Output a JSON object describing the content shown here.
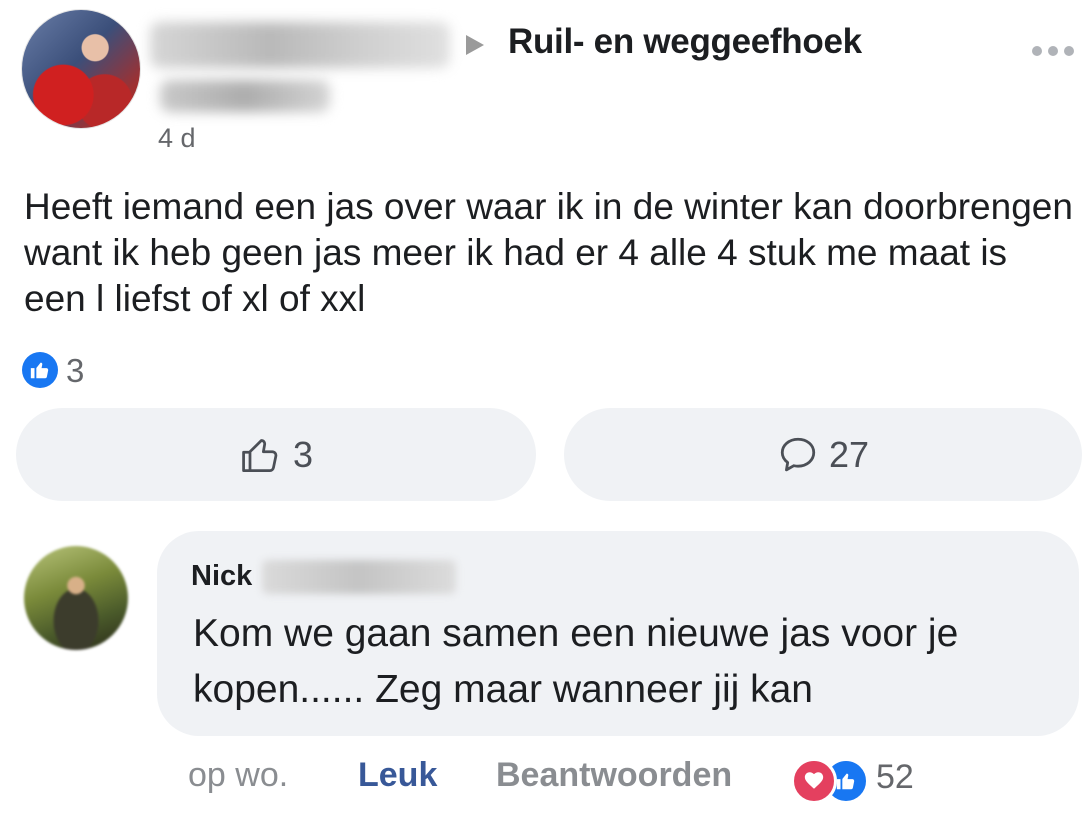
{
  "post": {
    "group_name": "Ruil- en weggeefhoek",
    "timestamp": "4 d",
    "text": "Heeft iemand een jas over waar ik in de winter kan doorbrengen want ik heb geen jas meer ik had er 4 alle 4 stuk me maat is een l liefst of xl of xxl",
    "reaction_count": "3"
  },
  "actions": {
    "like_count": "3",
    "comment_count": "27"
  },
  "comment": {
    "author_first_name": "Nick",
    "text": "Kom we gaan samen een nieuwe jas voor je kopen...... Zeg maar wanneer jij kan",
    "time": "op wo.",
    "like_label": "Leuk",
    "reply_label": "Beantwoorden",
    "reaction_count": "52"
  },
  "colors": {
    "facebook_blue": "#1877f2",
    "link_blue": "#385898",
    "love_red": "#e4405f",
    "bubble_gray": "#f0f2f5"
  },
  "icons": {
    "arrow": "right-triangle-icon",
    "more": "more-options-icon",
    "like": "thumbs-up-icon",
    "comment": "speech-bubble-icon",
    "love": "heart-icon"
  }
}
